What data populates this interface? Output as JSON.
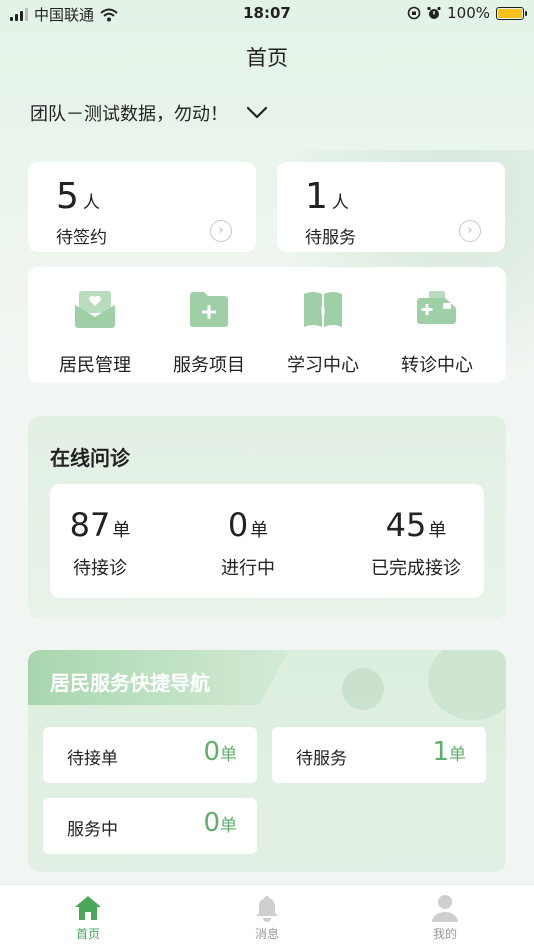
{
  "status_bar": {
    "carrier": "中国联通",
    "time": "18:07",
    "battery": "100%",
    "battery_level": 1.0
  },
  "header": {
    "title": "首页",
    "team_selector": "团队－测试数据，勿动！"
  },
  "stats": [
    {
      "value": "5",
      "unit": "人",
      "label": "待签约"
    },
    {
      "value": "1",
      "unit": "人",
      "label": "待服务"
    }
  ],
  "quick_menu": [
    {
      "label": "居民管理",
      "icon": "resident-management-icon"
    },
    {
      "label": "服务项目",
      "icon": "service-project-icon"
    },
    {
      "label": "学习中心",
      "icon": "learning-center-icon"
    },
    {
      "label": "转诊中心",
      "icon": "referral-center-icon"
    }
  ],
  "consultation": {
    "title": "在线问诊",
    "items": [
      {
        "value": "87",
        "unit": "单",
        "label": "待接诊"
      },
      {
        "value": "0",
        "unit": "单",
        "label": "进行中"
      },
      {
        "value": "45",
        "unit": "单",
        "label": "已完成接诊"
      }
    ]
  },
  "service_nav": {
    "title": "居民服务快捷导航",
    "items": [
      {
        "label": "待接单",
        "value": "0",
        "unit": "单"
      },
      {
        "label": "待服务",
        "value": "1",
        "unit": "单"
      },
      {
        "label": "服务中",
        "value": "0",
        "unit": "单"
      }
    ]
  },
  "tabbar": [
    {
      "label": "首页",
      "icon": "home-icon",
      "active": true
    },
    {
      "label": "消息",
      "icon": "bell-icon",
      "active": false
    },
    {
      "label": "我的",
      "icon": "user-icon",
      "active": false
    }
  ],
  "colors": {
    "accent": "#5fae6b",
    "icon_green": "#9fcfa6",
    "tab_active": "#4aa85a"
  }
}
